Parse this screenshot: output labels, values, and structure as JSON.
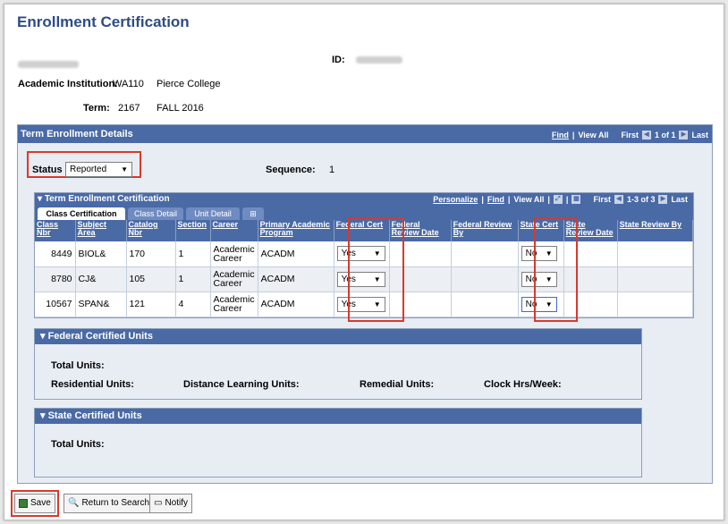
{
  "page": {
    "title": "Enrollment Certification"
  },
  "header": {
    "id_label": "ID:",
    "academic_institution_label": "Academic Institution:",
    "academic_institution_code": "WA110",
    "academic_institution_name": "Pierce College",
    "term_label": "Term:",
    "term_code": "2167",
    "term_name": "FALL 2016"
  },
  "term_panel": {
    "title": "Term Enrollment Details",
    "find": "Find",
    "view_all": "View All",
    "first": "First",
    "range": "1 of 1",
    "last": "Last",
    "status_label": "Status",
    "status_value": "Reported",
    "sequence_label": "Sequence:",
    "sequence_value": "1"
  },
  "grid": {
    "title": "Term Enrollment Certification",
    "personalize": "Personalize",
    "find": "Find",
    "view_all": "View All",
    "first": "First",
    "range": "1-3 of 3",
    "last": "Last",
    "tabs": [
      "Class Certification",
      "Class Detail",
      "Unit Detail"
    ],
    "columns": [
      "Class Nbr",
      "Subject Area",
      "Catalog Nbr",
      "Section",
      "Career",
      "Primary Academic Program",
      "Federal Cert",
      "Federal Review Date",
      "Federal Review By",
      "State Cert",
      "State Review Date",
      "State Review By"
    ],
    "rows": [
      {
        "class_nbr": "8449",
        "subject": "BIOL&",
        "catalog": "170",
        "section": "1",
        "career": "Academic Career",
        "program": "ACADM",
        "federal_cert": "Yes",
        "state_cert": "No"
      },
      {
        "class_nbr": "8780",
        "subject": "CJ&",
        "catalog": "105",
        "section": "1",
        "career": "Academic Career",
        "program": "ACADM",
        "federal_cert": "Yes",
        "state_cert": "No"
      },
      {
        "class_nbr": "10567",
        "subject": "SPAN&",
        "catalog": "121",
        "section": "4",
        "career": "Academic Career",
        "program": "ACADM",
        "federal_cert": "Yes",
        "state_cert": "No"
      }
    ]
  },
  "federal_units": {
    "title": "Federal Certified Units",
    "total_units": "Total Units:",
    "residential_units": "Residential Units:",
    "distance_units": "Distance Learning Units:",
    "remedial_units": "Remedial Units:",
    "clock_hrs": "Clock Hrs/Week:"
  },
  "state_units": {
    "title": "State Certified Units",
    "total_units": "Total Units:"
  },
  "buttons": {
    "save": "Save",
    "return_to_search": "Return to Search",
    "notify": "Notify"
  },
  "colors": {
    "accent": "#4a6aa6",
    "title": "#2d4c85",
    "highlight": "#d9392c"
  }
}
